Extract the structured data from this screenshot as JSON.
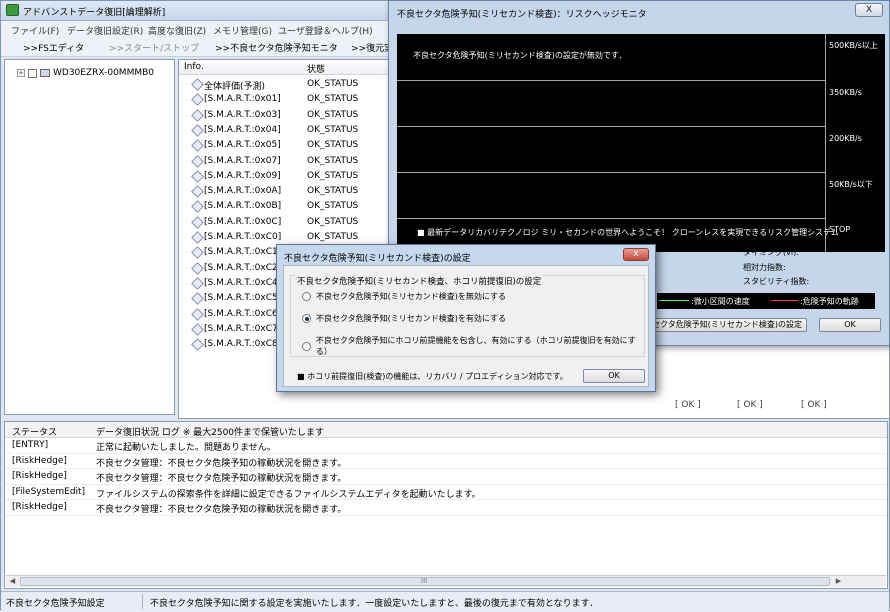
{
  "app": {
    "title": "アドバンストデータ復旧[論理解析]"
  },
  "menu": [
    "ファイル(F)",
    "データ復旧設定(R)",
    "高度な復旧(Z)",
    "メモリ管理(G)",
    "ユーザ登録＆ヘルプ(H)"
  ],
  "toolbar": {
    "fs_editor": ">>FSエディタ",
    "start_stop": ">>スタート/ストップ",
    "bad_sector_monitor": ">>不良セクタ危険予知モニタ",
    "restore": ">>復元実"
  },
  "tree": {
    "drive": "WD30EZRX-00MMMB0",
    "expander": "+"
  },
  "list": {
    "headers": {
      "info": "Info.",
      "status": "状態"
    },
    "rows": [
      {
        "info": "全体評価(予測)",
        "status": "OK_STATUS"
      },
      {
        "info": "[S.M.A.R.T.:0x01]",
        "status": "OK_STATUS"
      },
      {
        "info": "[S.M.A.R.T.:0x03]",
        "status": "OK_STATUS"
      },
      {
        "info": "[S.M.A.R.T.:0x04]",
        "status": "OK_STATUS"
      },
      {
        "info": "[S.M.A.R.T.:0x05]",
        "status": "OK_STATUS"
      },
      {
        "info": "[S.M.A.R.T.:0x07]",
        "status": "OK_STATUS"
      },
      {
        "info": "[S.M.A.R.T.:0x09]",
        "status": "OK_STATUS"
      },
      {
        "info": "[S.M.A.R.T.:0x0A]",
        "status": "OK_STATUS"
      },
      {
        "info": "[S.M.A.R.T.:0x0B]",
        "status": "OK_STATUS"
      },
      {
        "info": "[S.M.A.R.T.:0x0C]",
        "status": "OK_STATUS"
      },
      {
        "info": "[S.M.A.R.T.:0xC0]",
        "status": "OK_STATUS"
      },
      {
        "info": "[S.M.A.R.T.:0xC1]",
        "status": ""
      },
      {
        "info": "[S.M.A.R.T.:0xC2]",
        "status": ""
      },
      {
        "info": "[S.M.A.R.T.:0xC4]",
        "status": ""
      },
      {
        "info": "[S.M.A.R.T.:0xC5]",
        "status": ""
      },
      {
        "info": "[S.M.A.R.T.:0xC6]",
        "status": ""
      },
      {
        "info": "[S.M.A.R.T.:0xC7]",
        "status": ""
      },
      {
        "info": "[S.M.A.R.T.:0xC8]",
        "status": ""
      }
    ],
    "ok_cells": [
      "[ OK ]",
      "[ OK ]",
      "[ OK ]"
    ]
  },
  "log": {
    "headers": {
      "status": "ステータス",
      "detail": "データ復旧状況 ログ ※ 最大2500件まで保管いたします"
    },
    "rows": [
      {
        "key": "[ENTRY]",
        "msg": "正常に起動いたしました。問題ありません。"
      },
      {
        "key": "[RiskHedge]",
        "msg": "不良セクタ管理：不良セクタ危険予知の稼動状況を開きます。"
      },
      {
        "key": "[RiskHedge]",
        "msg": "不良セクタ管理：不良セクタ危険予知の稼動状況を開きます。"
      },
      {
        "key": "[FileSystemEdit]",
        "msg": "ファイルシステムの探索条件を詳細に設定できるファイルシステムエディタを起動いたします。"
      },
      {
        "key": "[RiskHedge]",
        "msg": "不良セクタ管理：不良セクタ危険予知の稼動状況を開きます。"
      }
    ],
    "scroll_grip": "III"
  },
  "statusbar": {
    "left": "不良セクタ危険予知設定",
    "right": "不良セクタ危険予知に関する設定を実施いたします．一度設定いたしますと、最後の復元まで有効となります．"
  },
  "monitor": {
    "title": "不良セクタ危険予知(ミリセカンド検査)：リスクヘッジモニタ",
    "close": "X",
    "disabled_msg": "不良セクタ危険予知(ミリセカンド検査)の設定が無効です．",
    "scale": [
      "500KB/s以上",
      "350KB/s",
      "200KB/s",
      "50KB/s以下",
      "STOP"
    ],
    "welcome": "■ 最新データリカバリテクノロジ ミリ・セカンドの世界へようこそ！ クローンレスを実現できるリスク管理システム",
    "timing": "タイミング(vi):",
    "relative": "相対力指数:",
    "stability": "スタビリティ指数:",
    "legend_speed": ":微小区間の速度",
    "legend_trace": ":危険予知の軌跡",
    "settings_btn": "セクタ危険予知(ミリセカンド検査)の設定",
    "ok_btn": "OK",
    "colors": {
      "speed": "#4cff4c",
      "trace": "#ff3030"
    }
  },
  "dialog": {
    "title": "不良セクタ危険予知(ミリセカンド検査)の設定",
    "close": "x",
    "group_title": "不良セクタ危険予知(ミリセカンド検査、ホコリ前提復旧)の設定",
    "options": [
      {
        "label": "不良セクタ危険予知(ミリセカンド検査)を無効にする",
        "selected": false
      },
      {
        "label": "不良セクタ危険予知(ミリセカンド検査)を有効にする",
        "selected": true
      },
      {
        "label": "不良セクタ危険予知にホコリ前提機能を包含し、有効にする（ホコリ前提復旧を有効にする）",
        "selected": false
      }
    ],
    "note": "■ ホコリ前提復旧(検査)の機能は、リカバリ / プロエディション対応です。",
    "ok": "OK"
  }
}
